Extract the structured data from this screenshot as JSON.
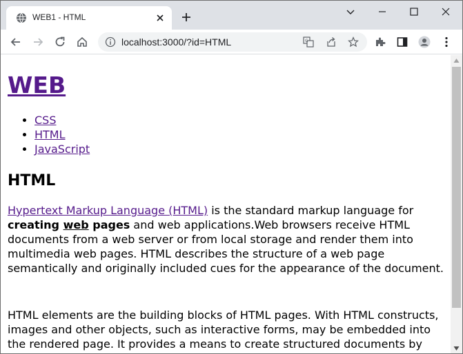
{
  "browser": {
    "tab_title": "WEB1 - HTML",
    "url": "localhost:3000/?id=HTML"
  },
  "page": {
    "site_title": "WEB",
    "nav": [
      "CSS",
      "HTML",
      "JavaScript"
    ],
    "heading": "HTML",
    "para1": {
      "link_text": "Hypertext Markup Language (HTML)",
      "text1": " is the standard markup language for ",
      "bold1": "creating ",
      "bold_underline": "web",
      "bold2": " pages",
      "text2": " and web applications.Web browsers receive HTML documents from a web server or from local storage and render them into multimedia web pages. HTML describes the structure of a web page semantically and originally included cues for the appearance of the document."
    },
    "para2": "HTML elements are the building blocks of HTML pages. With HTML constructs, images and other objects, such as interactive forms, may be embedded into the rendered page. It provides a means to create structured documents by denoting structural"
  },
  "colors": {
    "visited_link": "#551a8b",
    "tabstrip_bg": "#dee1e6",
    "omnibox_bg": "#f1f3f4"
  },
  "icons": [
    "globe-icon",
    "close-icon",
    "plus-icon",
    "chevron-down-icon",
    "minimize-icon",
    "maximize-icon",
    "back-icon",
    "forward-icon",
    "reload-icon",
    "home-icon",
    "info-icon",
    "translate-icon",
    "share-icon",
    "star-icon",
    "extensions-icon",
    "side-panel-icon",
    "profile-icon",
    "menu-icon"
  ]
}
